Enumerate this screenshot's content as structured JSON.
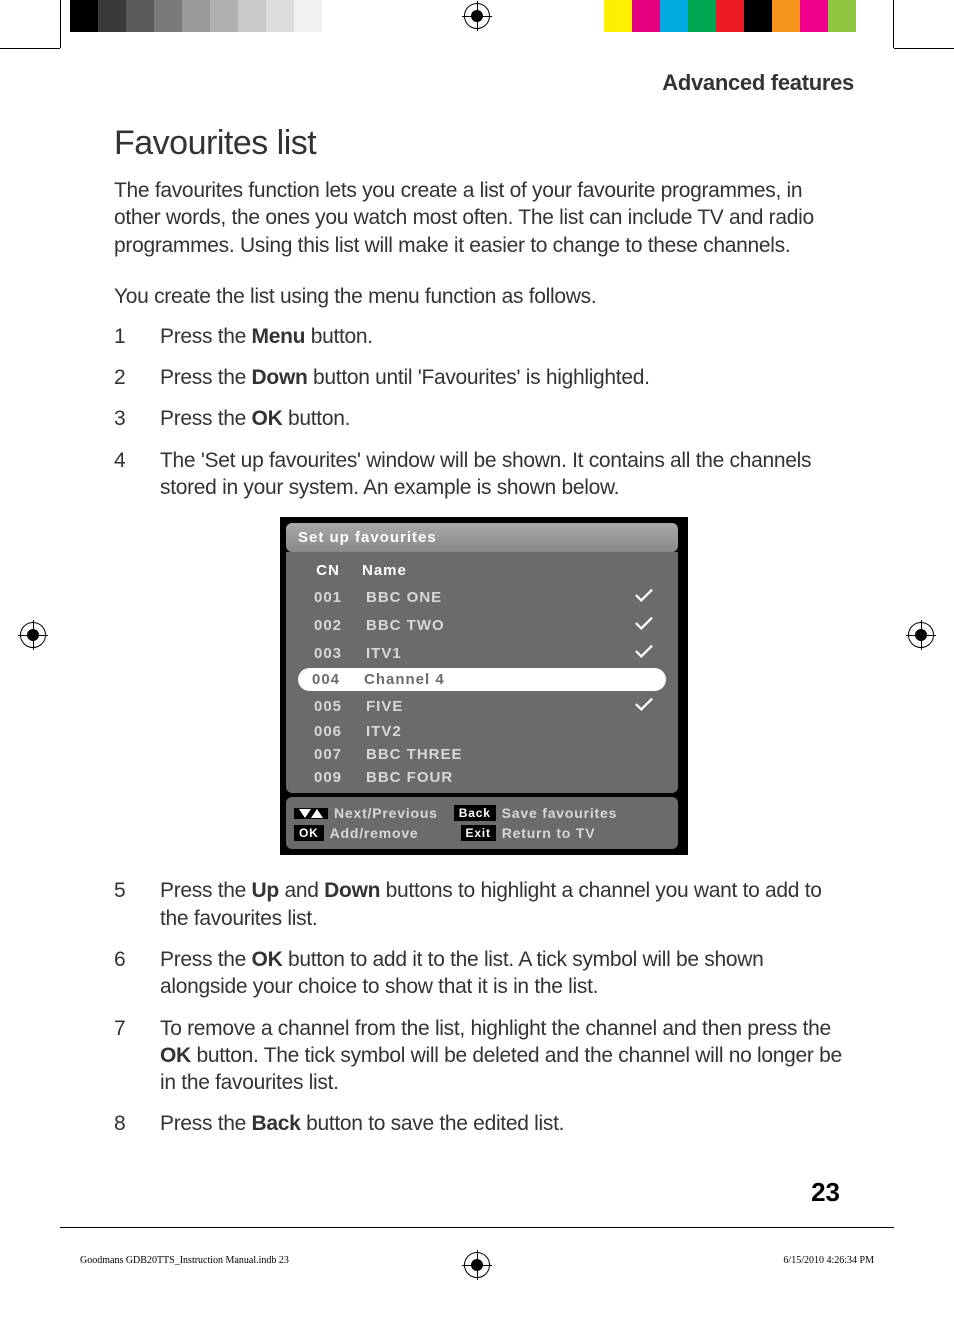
{
  "section": "Advanced features",
  "title": "Favourites list",
  "intro": "The favourites function lets you create a list of your favourite programmes, in other words, the ones you watch most often. The list can include TV and radio programmes. Using this list will make it easier to change to these channels.",
  "lead": "You create the list using the menu function as follows.",
  "steps": [
    {
      "n": "1",
      "text_parts": [
        "Press the ",
        "Menu",
        " button."
      ]
    },
    {
      "n": "2",
      "text_parts": [
        "Press the ",
        "Down",
        " button until 'Favourites' is highlighted."
      ]
    },
    {
      "n": "3",
      "text_parts": [
        "Press the ",
        "OK",
        " button."
      ]
    },
    {
      "n": "4",
      "text_parts": [
        "The 'Set up favourites' window will be shown. It contains all the channels stored in your system. An example is shown below."
      ]
    },
    {
      "n": "5",
      "text_parts": [
        "Press the ",
        "Up",
        " and ",
        "Down",
        " buttons to highlight a channel you want to add to the favourites list."
      ]
    },
    {
      "n": "6",
      "text_parts": [
        "Press the ",
        "OK",
        " button to add it to the list. A tick symbol will be shown alongside your choice to show that it is in the list."
      ]
    },
    {
      "n": "7",
      "text_parts": [
        "To remove a channel from the list, highlight the channel and then press the ",
        "OK",
        " button. The tick symbol will be deleted and the channel will no longer be in the favourites list."
      ]
    },
    {
      "n": "8",
      "text_parts": [
        "Press the ",
        "Back",
        " button to save the edited list."
      ]
    }
  ],
  "osd": {
    "title": "Set up favourites",
    "col_cn": "CN",
    "col_name": "Name",
    "rows": [
      {
        "cn": "001",
        "name": "BBC ONE",
        "checked": true,
        "selected": false
      },
      {
        "cn": "002",
        "name": "BBC TWO",
        "checked": true,
        "selected": false
      },
      {
        "cn": "003",
        "name": "ITV1",
        "checked": true,
        "selected": false
      },
      {
        "cn": "004",
        "name": "Channel 4",
        "checked": false,
        "selected": true
      },
      {
        "cn": "005",
        "name": "FIVE",
        "checked": true,
        "selected": false
      },
      {
        "cn": "006",
        "name": "ITV2",
        "checked": false,
        "selected": false
      },
      {
        "cn": "007",
        "name": "BBC THREE",
        "checked": false,
        "selected": false
      },
      {
        "cn": "009",
        "name": "BBC FOUR",
        "checked": false,
        "selected": false
      }
    ],
    "footer": {
      "next_prev": "Next/Previous",
      "back_btn": "Back",
      "save": "Save favourites",
      "ok_btn": "OK",
      "add_remove": "Add/remove",
      "exit_btn": "Exit",
      "return": "Return to TV"
    }
  },
  "page_number": "23",
  "footer_file": "Goodmans GDB20TTS_Instruction Manual.indb   23",
  "footer_date": "6/15/2010   4:26:34 PM",
  "color_bars_left": [
    "#000",
    "#3a3a3a",
    "#5a5a5a",
    "#7a7a7a",
    "#9a9a9a",
    "#b0b0b0",
    "#c8c8c8",
    "#dcdcdc",
    "#f0f0f0",
    "#fff"
  ],
  "color_bars_right": [
    "#fff000",
    "#e4007f",
    "#00a9e0",
    "#00a651",
    "#ed1c24",
    "#000",
    "#f7941d",
    "#ec008c",
    "#8dc63f",
    "#fff"
  ]
}
